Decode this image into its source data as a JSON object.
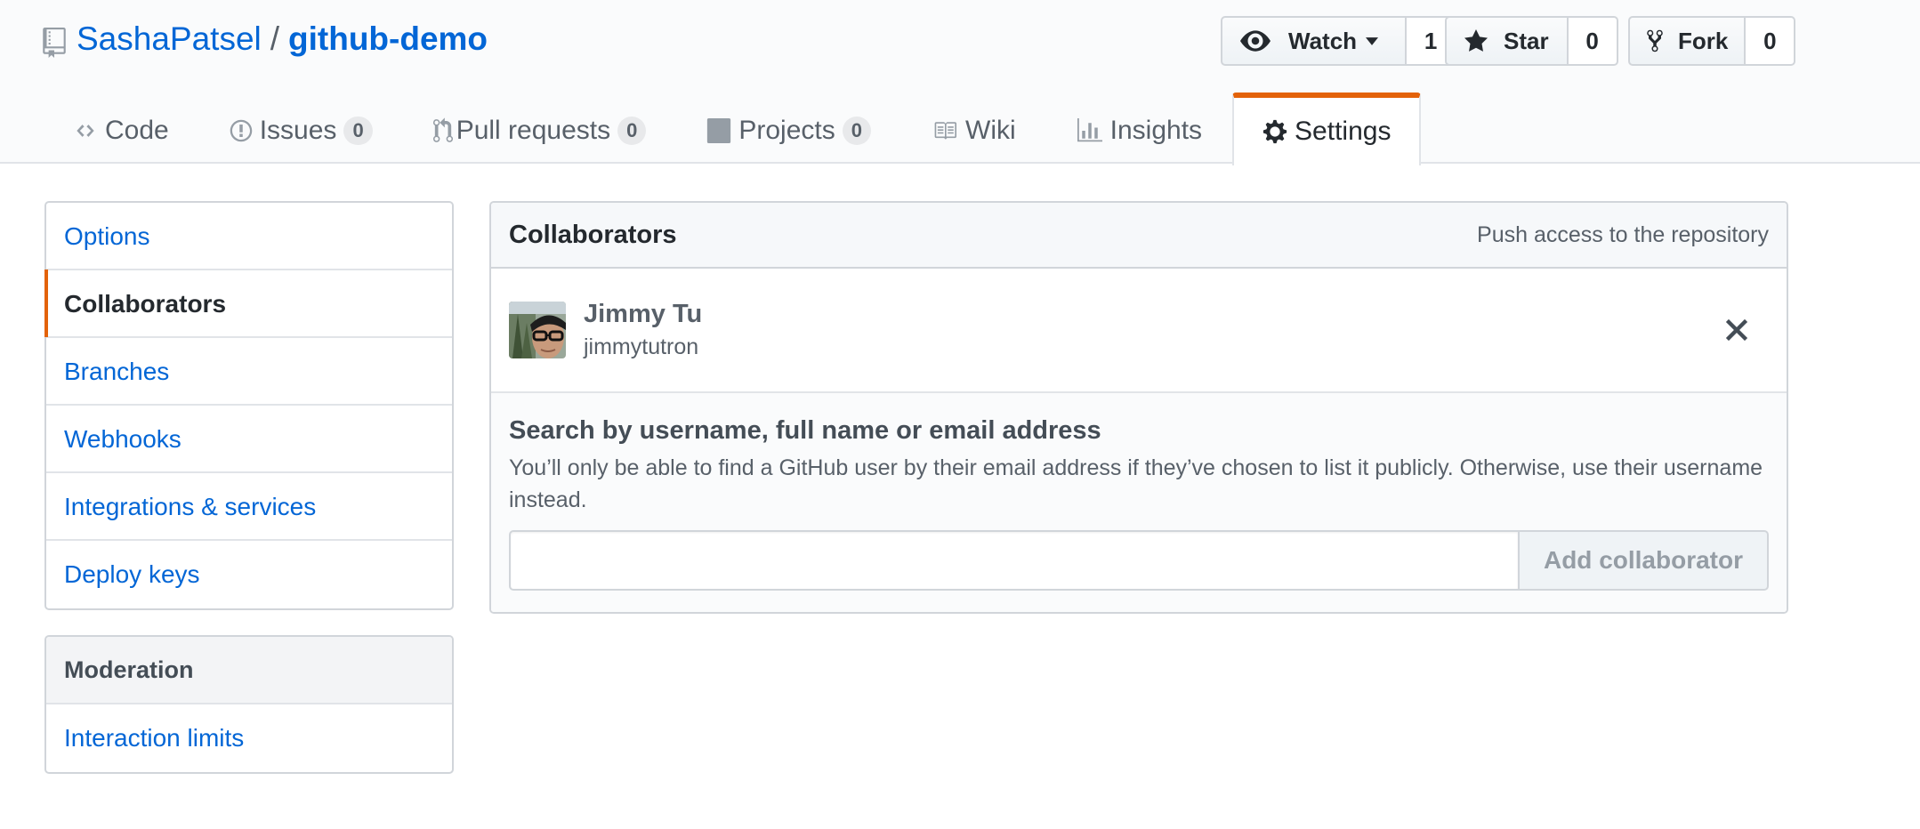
{
  "repo": {
    "owner": "SashaPatsel",
    "separator": "/",
    "name": "github-demo"
  },
  "actions": {
    "watch": {
      "label": "Watch",
      "count": "1"
    },
    "star": {
      "label": "Star",
      "count": "0"
    },
    "fork": {
      "label": "Fork",
      "count": "0"
    }
  },
  "nav": {
    "code": {
      "label": "Code"
    },
    "issues": {
      "label": "Issues",
      "count": "0"
    },
    "pulls": {
      "label": "Pull requests",
      "count": "0"
    },
    "projects": {
      "label": "Projects",
      "count": "0"
    },
    "wiki": {
      "label": "Wiki"
    },
    "insights": {
      "label": "Insights"
    },
    "settings": {
      "label": "Settings"
    }
  },
  "sidebar": {
    "items": [
      {
        "label": "Options"
      },
      {
        "label": "Collaborators"
      },
      {
        "label": "Branches"
      },
      {
        "label": "Webhooks"
      },
      {
        "label": "Integrations & services"
      },
      {
        "label": "Deploy keys"
      }
    ],
    "moderation": {
      "heading": "Moderation",
      "items": [
        {
          "label": "Interaction limits"
        }
      ]
    }
  },
  "collaborators": {
    "title": "Collaborators",
    "note": "Push access to the repository",
    "list": [
      {
        "name": "Jimmy Tu",
        "login": "jimmytutron"
      }
    ],
    "add": {
      "title": "Search by username, full name or email address",
      "note": "You’ll only be able to find a GitHub user by their email address if they’ve chosen to list it publicly. Otherwise, use their username instead.",
      "input_value": "",
      "button_label": "Add collaborator"
    }
  },
  "colors": {
    "link": "#0366d6",
    "accent": "#e36209",
    "border": "#d1d5da"
  }
}
